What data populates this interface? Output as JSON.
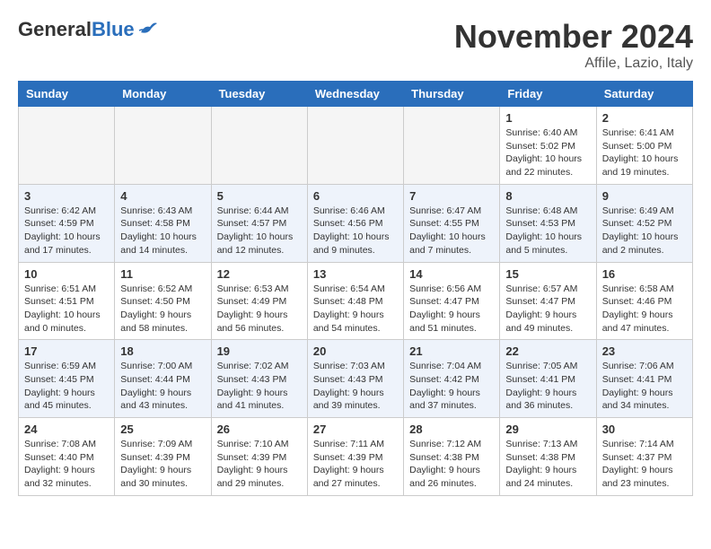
{
  "header": {
    "logo_general": "General",
    "logo_blue": "Blue",
    "month_title": "November 2024",
    "location": "Affile, Lazio, Italy"
  },
  "columns": [
    "Sunday",
    "Monday",
    "Tuesday",
    "Wednesday",
    "Thursday",
    "Friday",
    "Saturday"
  ],
  "weeks": [
    {
      "alt": false,
      "days": [
        {
          "num": "",
          "info": ""
        },
        {
          "num": "",
          "info": ""
        },
        {
          "num": "",
          "info": ""
        },
        {
          "num": "",
          "info": ""
        },
        {
          "num": "",
          "info": ""
        },
        {
          "num": "1",
          "info": "Sunrise: 6:40 AM\nSunset: 5:02 PM\nDaylight: 10 hours\nand 22 minutes."
        },
        {
          "num": "2",
          "info": "Sunrise: 6:41 AM\nSunset: 5:00 PM\nDaylight: 10 hours\nand 19 minutes."
        }
      ]
    },
    {
      "alt": true,
      "days": [
        {
          "num": "3",
          "info": "Sunrise: 6:42 AM\nSunset: 4:59 PM\nDaylight: 10 hours\nand 17 minutes."
        },
        {
          "num": "4",
          "info": "Sunrise: 6:43 AM\nSunset: 4:58 PM\nDaylight: 10 hours\nand 14 minutes."
        },
        {
          "num": "5",
          "info": "Sunrise: 6:44 AM\nSunset: 4:57 PM\nDaylight: 10 hours\nand 12 minutes."
        },
        {
          "num": "6",
          "info": "Sunrise: 6:46 AM\nSunset: 4:56 PM\nDaylight: 10 hours\nand 9 minutes."
        },
        {
          "num": "7",
          "info": "Sunrise: 6:47 AM\nSunset: 4:55 PM\nDaylight: 10 hours\nand 7 minutes."
        },
        {
          "num": "8",
          "info": "Sunrise: 6:48 AM\nSunset: 4:53 PM\nDaylight: 10 hours\nand 5 minutes."
        },
        {
          "num": "9",
          "info": "Sunrise: 6:49 AM\nSunset: 4:52 PM\nDaylight: 10 hours\nand 2 minutes."
        }
      ]
    },
    {
      "alt": false,
      "days": [
        {
          "num": "10",
          "info": "Sunrise: 6:51 AM\nSunset: 4:51 PM\nDaylight: 10 hours\nand 0 minutes."
        },
        {
          "num": "11",
          "info": "Sunrise: 6:52 AM\nSunset: 4:50 PM\nDaylight: 9 hours\nand 58 minutes."
        },
        {
          "num": "12",
          "info": "Sunrise: 6:53 AM\nSunset: 4:49 PM\nDaylight: 9 hours\nand 56 minutes."
        },
        {
          "num": "13",
          "info": "Sunrise: 6:54 AM\nSunset: 4:48 PM\nDaylight: 9 hours\nand 54 minutes."
        },
        {
          "num": "14",
          "info": "Sunrise: 6:56 AM\nSunset: 4:47 PM\nDaylight: 9 hours\nand 51 minutes."
        },
        {
          "num": "15",
          "info": "Sunrise: 6:57 AM\nSunset: 4:47 PM\nDaylight: 9 hours\nand 49 minutes."
        },
        {
          "num": "16",
          "info": "Sunrise: 6:58 AM\nSunset: 4:46 PM\nDaylight: 9 hours\nand 47 minutes."
        }
      ]
    },
    {
      "alt": true,
      "days": [
        {
          "num": "17",
          "info": "Sunrise: 6:59 AM\nSunset: 4:45 PM\nDaylight: 9 hours\nand 45 minutes."
        },
        {
          "num": "18",
          "info": "Sunrise: 7:00 AM\nSunset: 4:44 PM\nDaylight: 9 hours\nand 43 minutes."
        },
        {
          "num": "19",
          "info": "Sunrise: 7:02 AM\nSunset: 4:43 PM\nDaylight: 9 hours\nand 41 minutes."
        },
        {
          "num": "20",
          "info": "Sunrise: 7:03 AM\nSunset: 4:43 PM\nDaylight: 9 hours\nand 39 minutes."
        },
        {
          "num": "21",
          "info": "Sunrise: 7:04 AM\nSunset: 4:42 PM\nDaylight: 9 hours\nand 37 minutes."
        },
        {
          "num": "22",
          "info": "Sunrise: 7:05 AM\nSunset: 4:41 PM\nDaylight: 9 hours\nand 36 minutes."
        },
        {
          "num": "23",
          "info": "Sunrise: 7:06 AM\nSunset: 4:41 PM\nDaylight: 9 hours\nand 34 minutes."
        }
      ]
    },
    {
      "alt": false,
      "days": [
        {
          "num": "24",
          "info": "Sunrise: 7:08 AM\nSunset: 4:40 PM\nDaylight: 9 hours\nand 32 minutes."
        },
        {
          "num": "25",
          "info": "Sunrise: 7:09 AM\nSunset: 4:39 PM\nDaylight: 9 hours\nand 30 minutes."
        },
        {
          "num": "26",
          "info": "Sunrise: 7:10 AM\nSunset: 4:39 PM\nDaylight: 9 hours\nand 29 minutes."
        },
        {
          "num": "27",
          "info": "Sunrise: 7:11 AM\nSunset: 4:39 PM\nDaylight: 9 hours\nand 27 minutes."
        },
        {
          "num": "28",
          "info": "Sunrise: 7:12 AM\nSunset: 4:38 PM\nDaylight: 9 hours\nand 26 minutes."
        },
        {
          "num": "29",
          "info": "Sunrise: 7:13 AM\nSunset: 4:38 PM\nDaylight: 9 hours\nand 24 minutes."
        },
        {
          "num": "30",
          "info": "Sunrise: 7:14 AM\nSunset: 4:37 PM\nDaylight: 9 hours\nand 23 minutes."
        }
      ]
    }
  ]
}
